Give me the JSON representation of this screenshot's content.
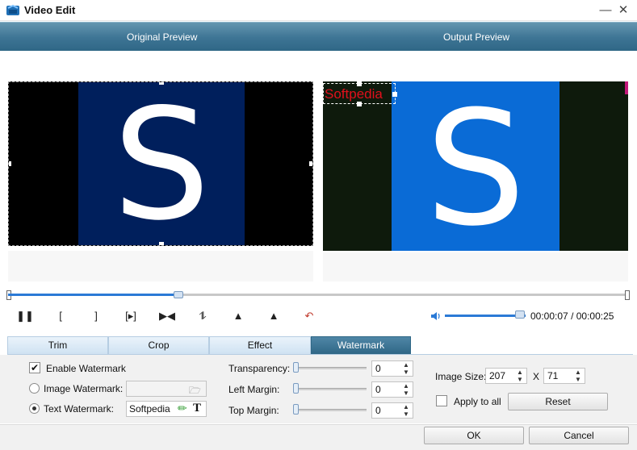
{
  "window": {
    "title": "Video Edit"
  },
  "preview": {
    "original_label": "Original Preview",
    "output_label": "Output Preview",
    "video_letter": "S",
    "watermark_overlay_text": "Softpedia"
  },
  "playback": {
    "current_time": "00:00:07",
    "separator": "/",
    "total_time": "00:00:25",
    "progress_fraction": 0.27,
    "volume_fraction": 0.9
  },
  "tabs": [
    {
      "label": "Trim"
    },
    {
      "label": "Crop"
    },
    {
      "label": "Effect"
    },
    {
      "label": "Watermark",
      "active": true
    }
  ],
  "watermark": {
    "enable_label": "Enable Watermark",
    "enable_checked": true,
    "image_watermark_label": "Image Watermark:",
    "image_watermark_value": "",
    "text_watermark_label": "Text Watermark:",
    "text_watermark_value": "Softpedia",
    "text_watermark_selected": true,
    "transparency_label": "Transparency:",
    "transparency_value": "0",
    "left_margin_label": "Left Margin:",
    "left_margin_value": "0",
    "top_margin_label": "Top  Margin:",
    "top_margin_value": "0",
    "image_size_label": "Image Size:",
    "image_width": "207",
    "image_size_x": "X",
    "image_height": "71",
    "apply_to_all_label": "Apply to all",
    "reset_label": "Reset"
  },
  "footer": {
    "ok_label": "OK",
    "cancel_label": "Cancel"
  },
  "colors": {
    "header_blue": "#2f6786",
    "accent_blue": "#2b7ad6",
    "video_bg_original": "#001f5c",
    "video_bg_output": "#0a6bd6",
    "watermark_red": "#e0101c"
  }
}
